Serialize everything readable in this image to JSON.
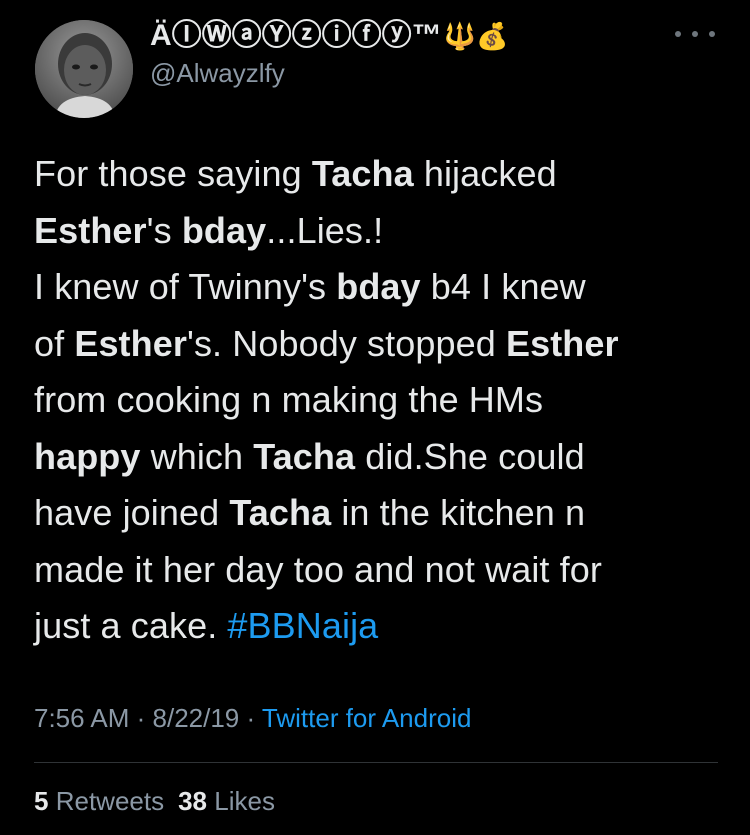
{
  "user": {
    "display_name": "ÄⒾⓌⓐⓎⓩⓘⓕⓨ™",
    "display_name_emojis": "🔱💰",
    "handle": "@Alwayzlfy",
    "avatar_icon": "profile-photo"
  },
  "menu": {
    "icon": "more-horizontal-icon"
  },
  "tweet": {
    "lines": [
      [
        {
          "t": "For those saying "
        },
        {
          "t": "Tacha",
          "b": true
        },
        {
          "t": " hijacked"
        }
      ],
      [
        {
          "t": "Esther",
          "b": true
        },
        {
          "t": "'s "
        },
        {
          "t": "bday",
          "b": true
        },
        {
          "t": "...Lies.!"
        }
      ],
      [
        {
          "t": "I knew of Twinny's "
        },
        {
          "t": "bday",
          "b": true
        },
        {
          "t": " b4 I knew"
        }
      ],
      [
        {
          "t": "of "
        },
        {
          "t": "Esther",
          "b": true
        },
        {
          "t": "'s. Nobody stopped "
        },
        {
          "t": "Esther",
          "b": true
        }
      ],
      [
        {
          "t": "from cooking n making the HMs"
        }
      ],
      [
        {
          "t": "happy",
          "b": true
        },
        {
          "t": " which "
        },
        {
          "t": "Tacha",
          "b": true
        },
        {
          "t": " did.She could"
        }
      ],
      [
        {
          "t": "have joined "
        },
        {
          "t": "Tacha",
          "b": true
        },
        {
          "t": " in the kitchen n"
        }
      ],
      [
        {
          "t": "made it her day too and not wait for"
        }
      ],
      [
        {
          "t": "just a cake. "
        },
        {
          "t": "#BBNaija",
          "link": true
        }
      ]
    ]
  },
  "meta": {
    "time": "7:56 AM",
    "separator": " · ",
    "date": "8/22/19",
    "source": "Twitter for Android"
  },
  "stats": {
    "retweets_count": "5",
    "retweets_label": "Retweets",
    "likes_count": "38",
    "likes_label": "Likes"
  },
  "colors": {
    "background": "#000000",
    "text": "#e7e9ea",
    "secondary": "#8b98a5",
    "link": "#1d9bf0",
    "divider": "#2f3336"
  }
}
